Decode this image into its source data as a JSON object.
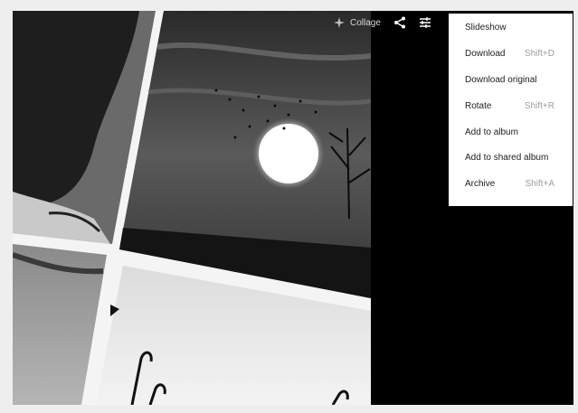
{
  "toolbar": {
    "collage_label": "Collage",
    "icons": [
      "sparkle-icon",
      "share-icon",
      "tune-icon"
    ]
  },
  "menu": {
    "items": [
      {
        "label": "Slideshow",
        "shortcut": ""
      },
      {
        "label": "Download",
        "shortcut": "Shift+D"
      },
      {
        "label": "Download original",
        "shortcut": ""
      },
      {
        "label": "Rotate",
        "shortcut": "Shift+R"
      },
      {
        "label": "Add to album",
        "shortcut": ""
      },
      {
        "label": "Add to shared album",
        "shortcut": ""
      },
      {
        "label": "Archive",
        "shortcut": "Shift+A"
      }
    ]
  },
  "colors": {
    "viewer_background": "#000000",
    "menu_background": "#ffffff",
    "menu_text": "#212121",
    "shortcut_text": "#9e9e9e"
  }
}
